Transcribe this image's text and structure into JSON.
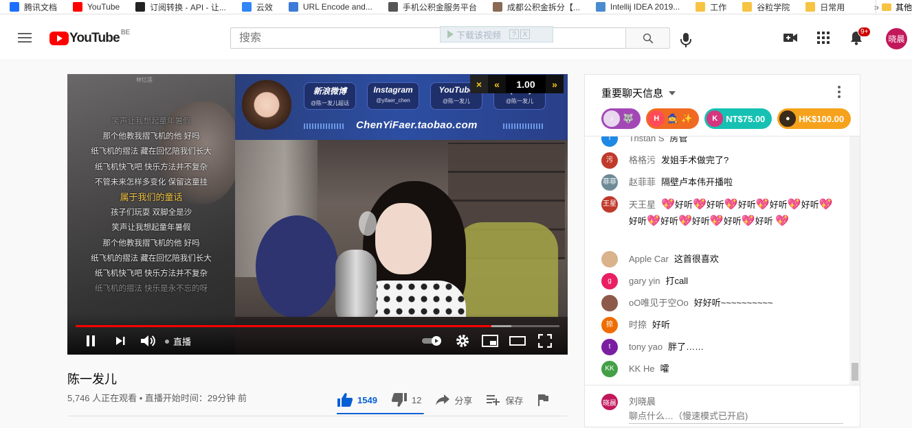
{
  "bookmarks": [
    {
      "label": "腾讯文档",
      "icon": "tencent-docs-icon",
      "color": "#1e6fff"
    },
    {
      "label": "YouTube",
      "icon": "youtube-icon",
      "color": "#ff0000"
    },
    {
      "label": "订阅转换 - API - 让...",
      "icon": "apple-icon",
      "color": "#222222"
    },
    {
      "label": "云效",
      "icon": "yunxiao-icon",
      "color": "#2f86f6"
    },
    {
      "label": "URL Encode and...",
      "icon": "url-icon",
      "color": "#3d7bd8"
    },
    {
      "label": "手机公积金服务平台",
      "icon": "globe-icon",
      "color": "#555555"
    },
    {
      "label": "成都公积金拆分【...",
      "icon": "person-icon",
      "color": "#8a6a55"
    },
    {
      "label": "Intellij IDEA 2019...",
      "icon": "map-pin-icon",
      "color": "#4a8bd0"
    },
    {
      "label": "工作",
      "icon": "folder-icon",
      "color": "#f6c343"
    },
    {
      "label": "谷粒学院",
      "icon": "folder-icon",
      "color": "#f6c343"
    },
    {
      "label": "日常用",
      "icon": "folder-icon",
      "color": "#f6c343"
    }
  ],
  "bookmarks_more": "»",
  "bookmarks_other": "其他",
  "logo": {
    "text": "YouTube",
    "region": "BE"
  },
  "search": {
    "placeholder": "搜索"
  },
  "download_tip": {
    "label": "下载该视频",
    "help": "?",
    "close": "X"
  },
  "notifications": {
    "badge": "9+"
  },
  "user": {
    "avatar_text": "晓晨",
    "name": "刘晓晨"
  },
  "player": {
    "speed": "1.00",
    "speed_close": "×",
    "speed_slower": "«",
    "speed_faster": "»",
    "live_label": "直播",
    "progress_played": 0.86,
    "progress_buffered": 0.9,
    "lyrics_header": "林忆莲",
    "lyrics": [
      {
        "text": "笑声让我想起童年暑假",
        "style": "dim"
      },
      {
        "text": "那个他教我摺飞机的他 好吗",
        "style": ""
      },
      {
        "text": "纸飞机的摺法 藏在回忆陪我们长大",
        "style": ""
      },
      {
        "text": "纸飞机快飞吧 快乐方法并不复杂",
        "style": ""
      },
      {
        "text": "不管未来怎样多变化 保留这童挂",
        "style": ""
      },
      {
        "text": "属于我们的童话",
        "style": "hl"
      },
      {
        "text": "孩子们玩耍 双脚全是沙",
        "style": ""
      },
      {
        "text": "笑声让我想起童年暑假",
        "style": ""
      },
      {
        "text": "那个他教我摺飞机的他 好吗",
        "style": ""
      },
      {
        "text": "纸飞机的摺法 藏在回忆陪我们长大",
        "style": ""
      },
      {
        "text": "纸飞机快飞吧 快乐方法并不复杂",
        "style": ""
      },
      {
        "text": "纸飞机的摺法 快乐是永不忘的呀",
        "style": "dim"
      }
    ],
    "banner": {
      "socials": [
        {
          "title": "新浪微博",
          "sub": "@陈一发儿超话"
        },
        {
          "title": "Instagram",
          "sub": "@yifaer_chen"
        },
        {
          "title": "YouTube",
          "sub": "@陈一发儿"
        },
        {
          "title": "Spotify",
          "sub": "@陈一发儿"
        }
      ],
      "shop": "ChenYiFaer.taobao.com"
    }
  },
  "video": {
    "title": "陈一发儿",
    "meta": "5,746 人正在观看 • 直播开始时间：29分钟 前",
    "likes": "1549",
    "dislikes": "12",
    "share": "分享",
    "save": "保存",
    "like_ratio": 0.992
  },
  "chat": {
    "title": "重要聊天信息",
    "tickers": [
      {
        "label": "",
        "color": "#a347b6",
        "avatar_color": "#e8d7ef",
        "avatar_text": "♪",
        "extra": "🐺"
      },
      {
        "label": "",
        "color": "#f06a22",
        "avatar_color": "#ff4b58",
        "avatar_text": "H",
        "extra": "🧙 ✨"
      },
      {
        "label": "NT$75.00",
        "color": "#16c1b3",
        "avatar_color": "#d6357e",
        "avatar_text": "K",
        "extra": ""
      },
      {
        "label": "HK$100.00",
        "color": "#f6a21c",
        "avatar_color": "#3a2a1a",
        "avatar_text": "●",
        "extra": ""
      }
    ],
    "messages": [
      {
        "author": "Tristan S",
        "text": "房管",
        "avatar_text": "T",
        "avatar_color": "#1e88e5"
      },
      {
        "author": "格格污",
        "text": "发姐手术做完了?",
        "avatar_text": "污",
        "avatar_color": "#c0392b"
      },
      {
        "author": "赵菲菲",
        "text": "隔壁卢本伟开播啦",
        "avatar_text": "菲菲",
        "avatar_color": "#6d8a96"
      },
      {
        "author": "天王星",
        "text": "好听",
        "avatar_text": "王星",
        "avatar_color": "#c0392b",
        "repeat": 11
      },
      {
        "author": "Apple Car",
        "text": "这首很喜欢",
        "avatar_text": "",
        "avatar_color": "#d9b38c"
      },
      {
        "author": "gary yin",
        "text": "打call",
        "avatar_text": "g",
        "avatar_color": "#e91e63"
      },
      {
        "author": "oO唯见于空Oo",
        "text": "好好听~~~~~~~~~~",
        "avatar_text": "",
        "avatar_color": "#8d5a4a"
      },
      {
        "author": "时捺",
        "text": "好听",
        "avatar_text": "捺",
        "avatar_color": "#ef6c00"
      },
      {
        "author": "tony yao",
        "text": "胖了……",
        "avatar_text": "t",
        "avatar_color": "#7b1fa2"
      },
      {
        "author": "KK He",
        "text": "嚯",
        "avatar_text": "KK",
        "avatar_color": "#43a047"
      }
    ],
    "input_placeholder": "聊点什么…（慢速模式已开启)"
  }
}
